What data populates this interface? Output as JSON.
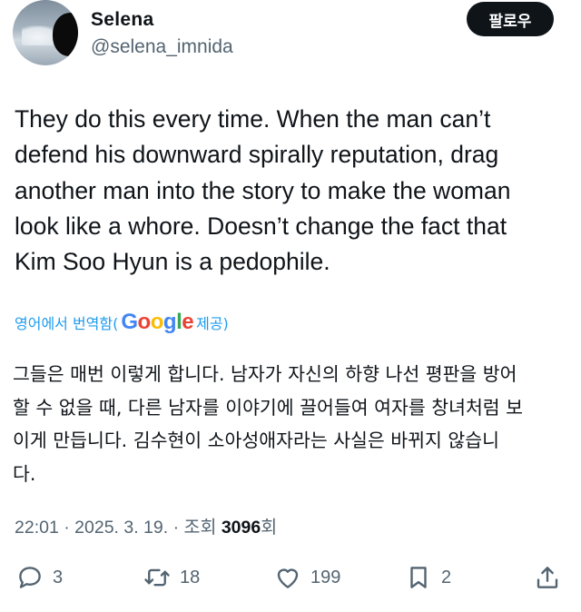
{
  "author": {
    "display_name": "Selena",
    "handle": "@selena_imnida"
  },
  "follow_button": {
    "label": "팔로우"
  },
  "tweet": {
    "text": "They do this every time. When the man can’t\ndefend his downward spirally reputation, drag\nanother man into the story to make the woman\nlook like a whore. Doesn’t change the fact that\nKim Soo Hyun is a pedophile."
  },
  "translation": {
    "prefix": "영어에서 번역함(",
    "provider_letters": [
      "G",
      "o",
      "o",
      "g",
      "l",
      "e"
    ],
    "suffix": " 제공)",
    "text": "그들은 매번 이렇게 합니다. 남자가 자신의 하향 나선 평판을 방어\n할 수 없을 때, 다른 남자를 이야기에 끌어들여 여자를 창녀처럼 보\n이게 만듭니다. 김수현이 소아성애자라는 사실은 바뀌지 않습니\n다."
  },
  "meta": {
    "time": "22:01",
    "date": "2025. 3. 19.",
    "views_label": "조회",
    "views_count": "3096",
    "views_suffix": "회"
  },
  "actions": {
    "reply_count": "3",
    "retweet_count": "18",
    "like_count": "199",
    "bookmark_count": "2"
  },
  "colors": {
    "text": "#0f1419",
    "secondary": "#536471",
    "link": "#1d9bf0",
    "button_bg": "#0f1419"
  },
  "icons": [
    "reply-icon",
    "retweet-icon",
    "like-icon",
    "bookmark-icon",
    "share-icon"
  ]
}
